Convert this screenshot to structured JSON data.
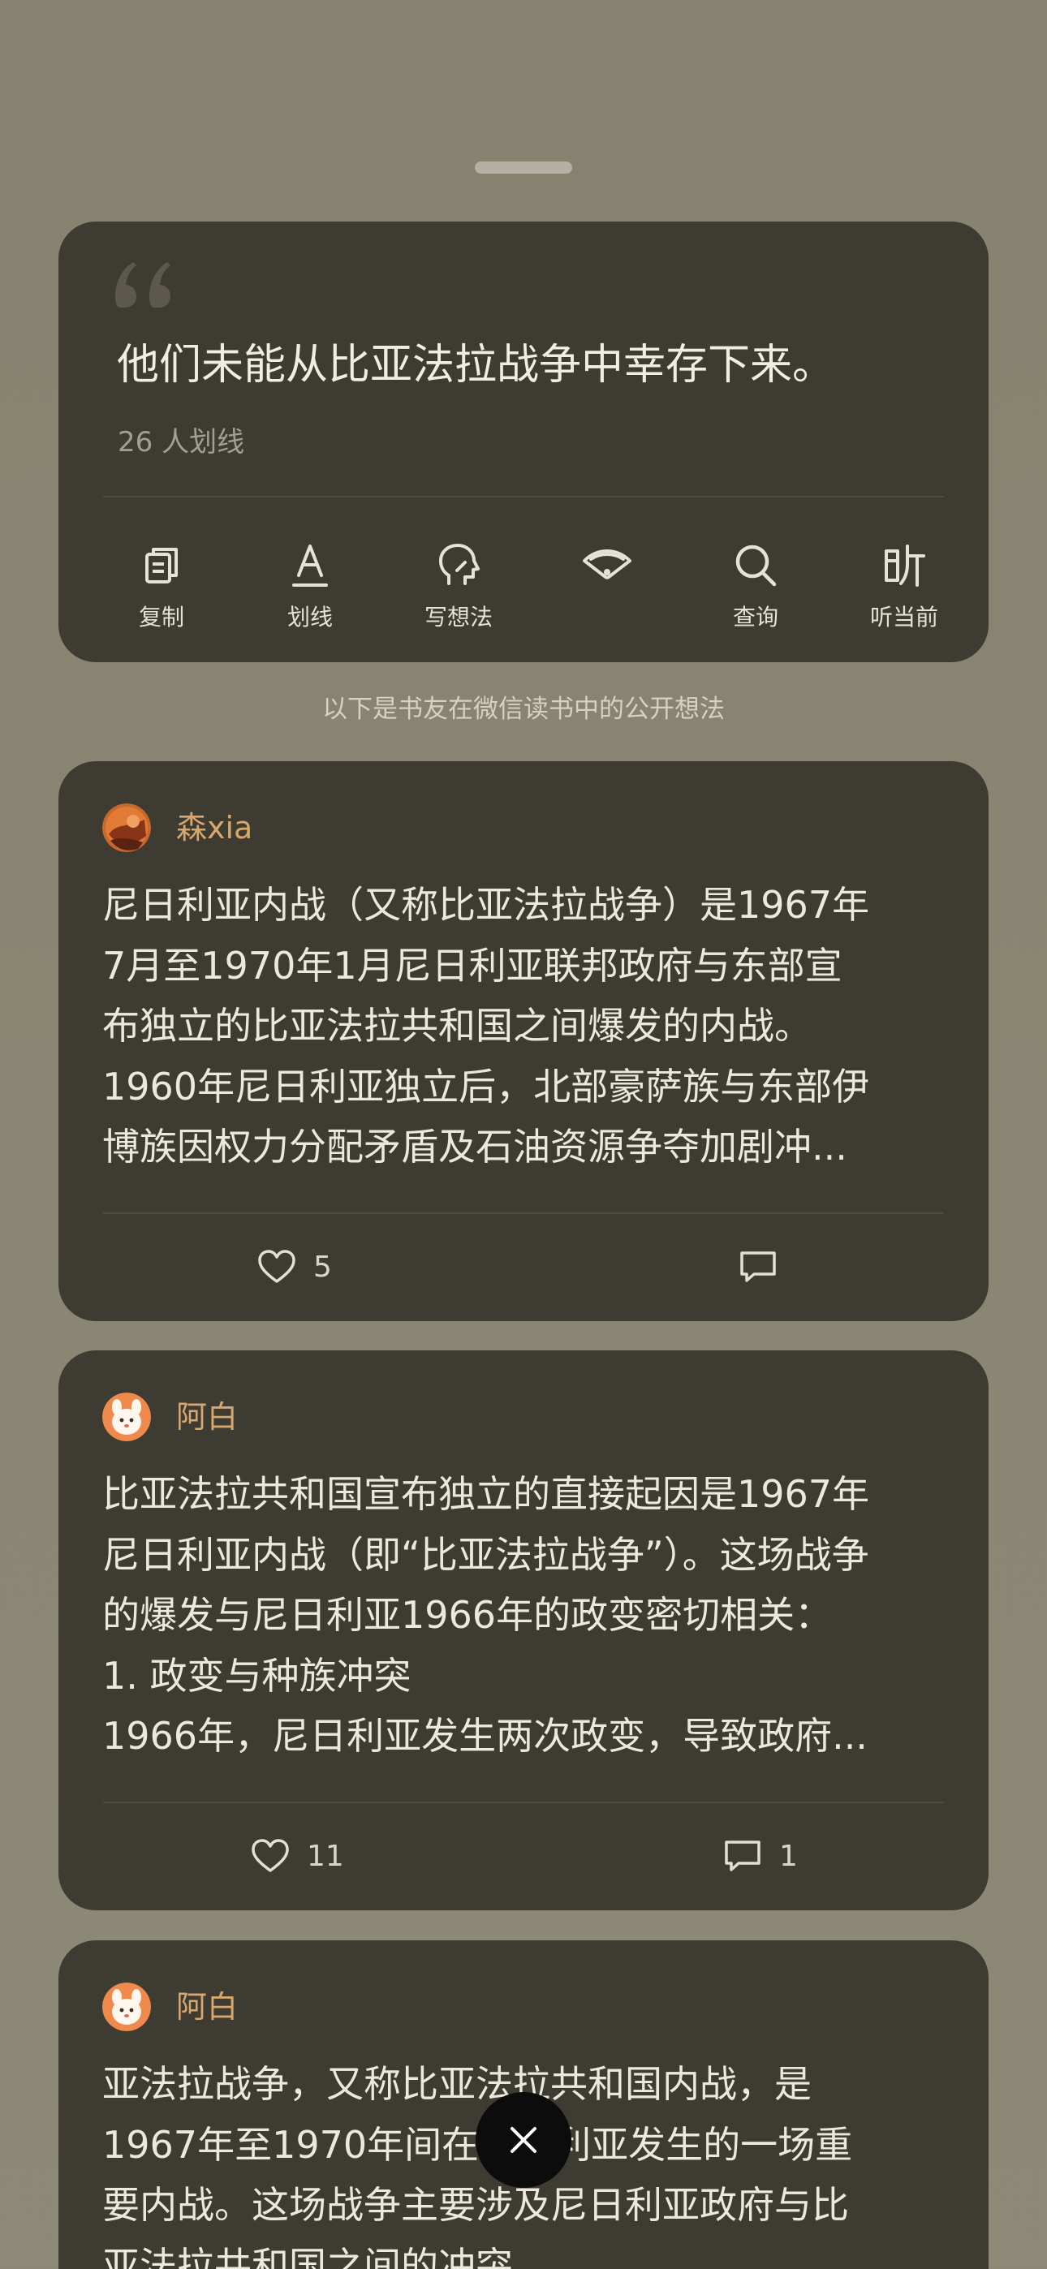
{
  "quote": {
    "text": "他们未能从比亚法拉战争中幸存下来。",
    "count_label": "26 人划线"
  },
  "toolbar": {
    "items": [
      {
        "label": "复制",
        "icon": "copy-icon"
      },
      {
        "label": "划线",
        "icon": "underline-icon"
      },
      {
        "label": "写想法",
        "icon": "write-thought-icon"
      },
      {
        "label": "",
        "icon": "share-fan-icon"
      },
      {
        "label": "查询",
        "icon": "search-icon"
      },
      {
        "label": "听当前",
        "icon": "listen-icon"
      }
    ]
  },
  "section_note": "以下是书友在微信读书中的公开想法",
  "comments": [
    {
      "user": "森xia",
      "lines": [
        "尼日利亚内战（又称比亚法拉战争）是1967年",
        "7月至1970年1月尼日利亚联邦政府与东部宣",
        "布独立的比亚法拉共和国之间爆发的内战。",
        "1960年尼日利亚独立后，北部豪萨族与东部伊",
        "博族因权力分配矛盾及石油资源争夺加剧冲..."
      ],
      "likes": "5",
      "replies": ""
    },
    {
      "user": "阿白",
      "lines": [
        "比亚法拉共和国宣布独立的直接起因是1967年",
        "尼日利亚内战（即“比亚法拉战争”）。这场战争",
        "的爆发与尼日利亚1966年的政变密切相关：",
        "1. 政变与种族冲突",
        "1966年，尼日利亚发生两次政变，导致政府..."
      ],
      "likes": "11",
      "replies": "1"
    },
    {
      "user": "阿白",
      "lines": [
        "亚法拉战争，又称比亚法拉共和国内战，是",
        "1967年至1970年间在尼日利亚发生的一场重",
        "要内战。这场战争主要涉及尼日利亚政府与比",
        "亚法拉共和国之间的冲突。"
      ],
      "likes": "",
      "replies": ""
    }
  ],
  "colors": {
    "background": "#88846f",
    "card": "#3e3b32",
    "username": "#d7a76d",
    "close_button": "#0c0c0c"
  }
}
